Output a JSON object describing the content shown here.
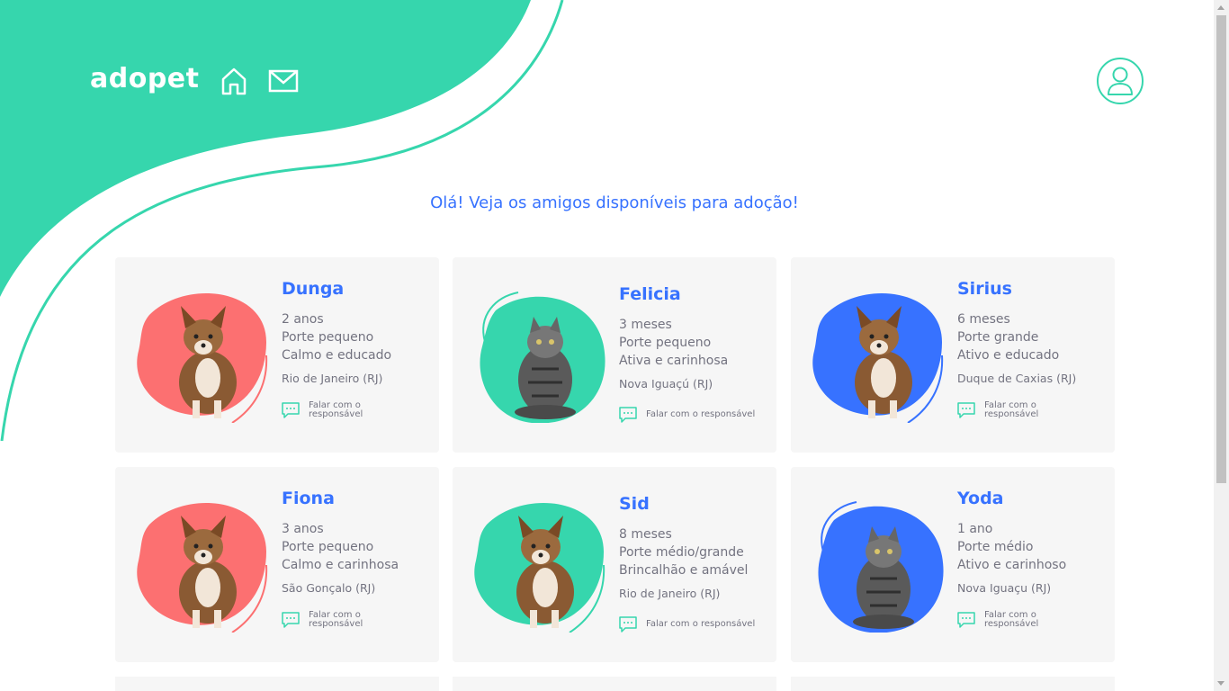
{
  "colors": {
    "accent": "#36d6ad",
    "heading": "#3772ff",
    "card_bg": "#f6f6f6",
    "text": "#737380",
    "coral": "#fc7071"
  },
  "header": {
    "logo": "adopet",
    "icons": [
      "home-icon",
      "mail-icon",
      "user-profile-icon"
    ]
  },
  "main": {
    "heading": "Olá! Veja os amigos disponíveis para adoção!"
  },
  "pets": [
    {
      "name": "Dunga",
      "age": "2 anos",
      "size": "Porte pequeno",
      "temper": "Calmo e educado",
      "location": "Rio de Janeiro (RJ)",
      "contact": "Falar com o responsável",
      "blob_color": "#fc7071",
      "animal": "dog"
    },
    {
      "name": "Felicia",
      "age": "3 meses",
      "size": "Porte pequeno",
      "temper": "Ativa e carinhosa",
      "location": "Nova Iguaçú (RJ)",
      "contact": "Falar com o responsável",
      "blob_color": "#36d6ad",
      "animal": "cat"
    },
    {
      "name": "Sirius",
      "age": "6 meses",
      "size": "Porte grande",
      "temper": "Ativo e educado",
      "location": "Duque de Caxias (RJ)",
      "contact": "Falar com o responsável",
      "blob_color": "#3772ff",
      "animal": "dog"
    },
    {
      "name": "Fiona",
      "age": "3 anos",
      "size": "Porte pequeno",
      "temper": "Calmo e carinhosa",
      "location": "São Gonçalo (RJ)",
      "contact": "Falar com o responsável",
      "blob_color": "#fc7071",
      "animal": "dog"
    },
    {
      "name": "Sid",
      "age": "8 meses",
      "size": "Porte médio/grande",
      "temper": "Brincalhão e amável",
      "location": "Rio de Janeiro (RJ)",
      "contact": "Falar com o responsável",
      "blob_color": "#36d6ad",
      "animal": "dog"
    },
    {
      "name": "Yoda",
      "age": "1 ano",
      "size": "Porte médio",
      "temper": "Ativo e carinhoso",
      "location": "Nova Iguaçu (RJ)",
      "contact": "Falar com o responsável",
      "blob_color": "#3772ff",
      "animal": "cat"
    }
  ]
}
